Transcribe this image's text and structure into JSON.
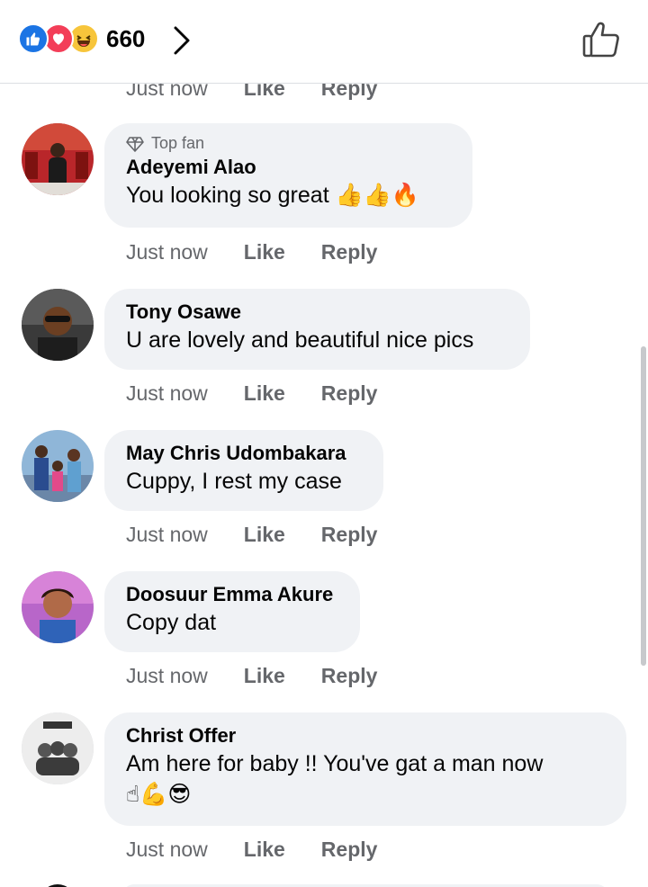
{
  "header": {
    "reaction_count": "660",
    "reactions": [
      "like-icon",
      "love-icon",
      "haha-icon"
    ]
  },
  "partial_row": {
    "time": "Just now",
    "like": "Like",
    "reply": "Reply"
  },
  "comments": [
    {
      "badge": "Top fan",
      "name": "Adeyemi Alao",
      "text": "You looking so great",
      "emojis": "👍👍🔥",
      "time": "Just now",
      "like": "Like",
      "reply": "Reply"
    },
    {
      "badge": "",
      "name": "Tony Osawe",
      "text": "U are lovely and beautiful nice pics",
      "emojis": "",
      "time": "Just now",
      "like": "Like",
      "reply": "Reply"
    },
    {
      "badge": "",
      "name": "May Chris Udombakara",
      "text": "Cuppy, I rest my case",
      "emojis": "",
      "time": "Just now",
      "like": "Like",
      "reply": "Reply"
    },
    {
      "badge": "",
      "name": "Doosuur Emma Akure",
      "text": "Copy dat",
      "emojis": "",
      "time": "Just now",
      "like": "Like",
      "reply": "Reply"
    },
    {
      "badge": "",
      "name": "Christ Offer",
      "text": "Am here for baby !! You've gat a man now",
      "emojis": "☝💪😎",
      "time": "Just now",
      "like": "Like",
      "reply": "Reply"
    }
  ],
  "colors": {
    "accent": "#1b74e4",
    "bubble": "#f0f2f5",
    "meta": "#65676b"
  }
}
